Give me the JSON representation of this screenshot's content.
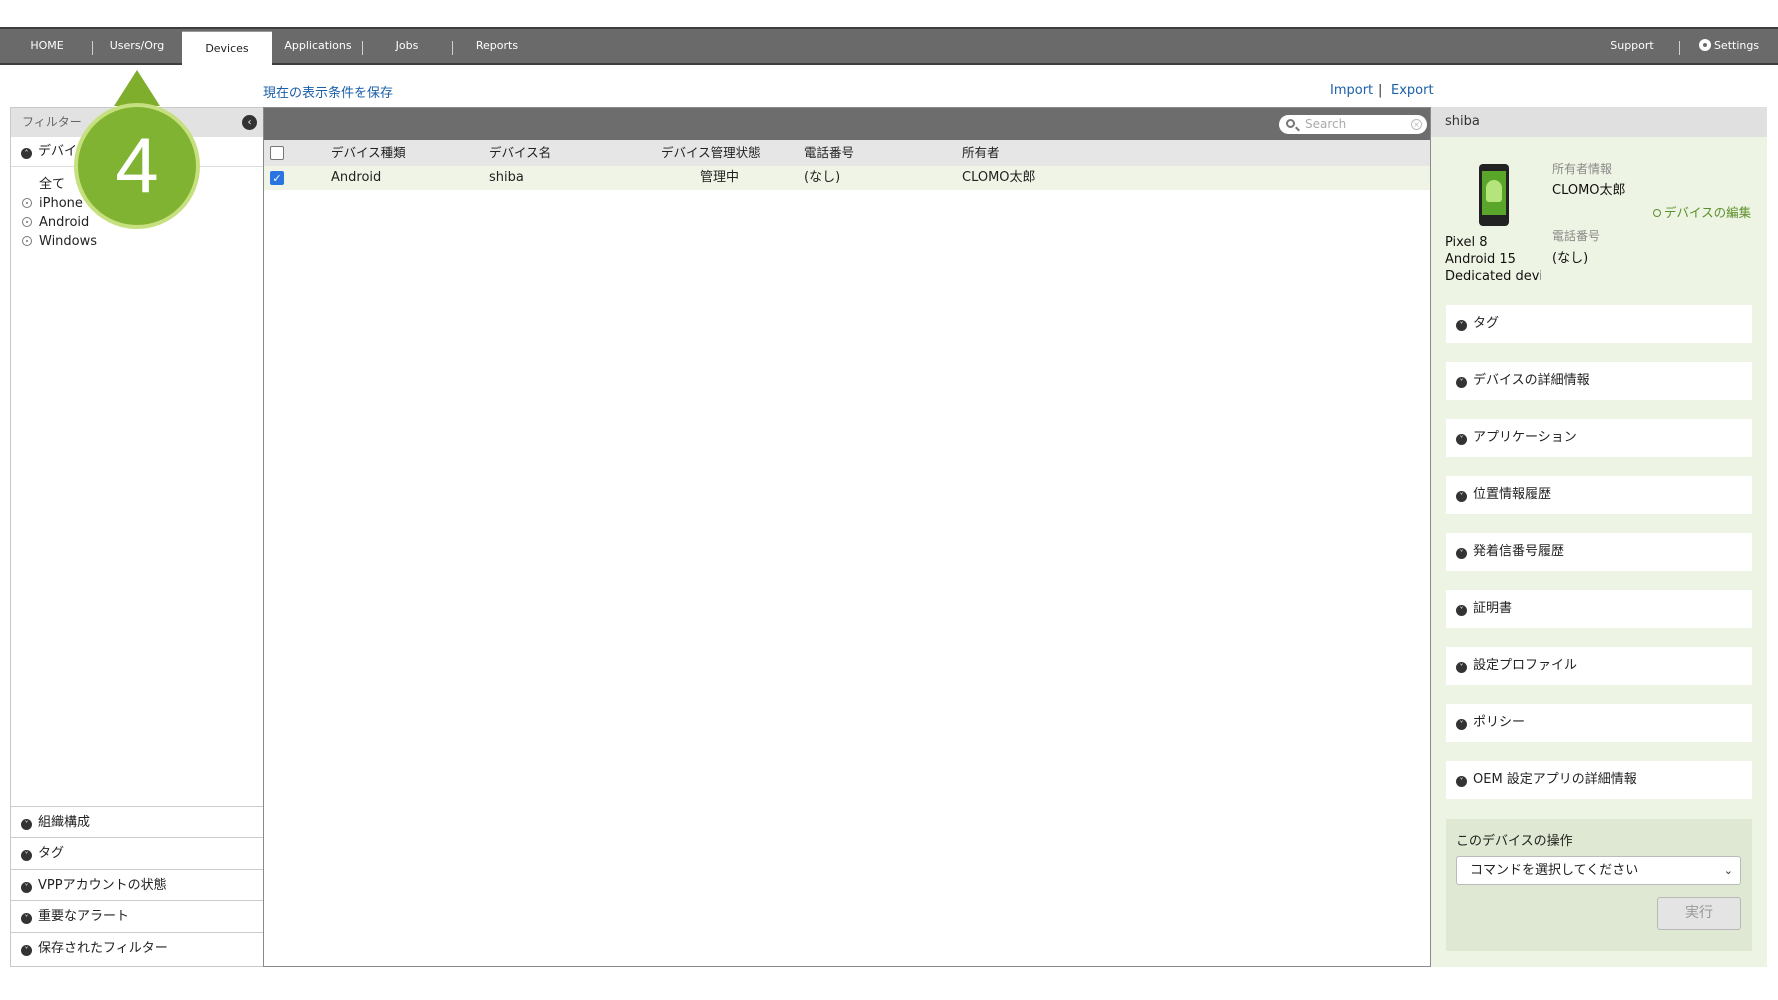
{
  "nav": {
    "tabs": [
      "HOME",
      "Users/Org",
      "Devices",
      "Applications",
      "Jobs",
      "Reports"
    ],
    "active_tab": "Devices",
    "support": "Support",
    "settings": "Settings"
  },
  "toolbar": {
    "save_view": "現在の表示条件を保存",
    "import": "Import",
    "separator": "|",
    "export": "Export"
  },
  "filter": {
    "header": "フィルター",
    "device_section": "デバイ",
    "options": [
      "全て",
      "iPhone",
      "Android",
      "Windows"
    ],
    "bottom_sections": [
      "組織構成",
      "タグ",
      "VPPアカウントの状態",
      "重要なアラート",
      "保存されたフィルター"
    ]
  },
  "list": {
    "search_placeholder": "Search",
    "columns": [
      "デバイス種類",
      "デバイス名",
      "デバイス管理状態",
      "電話番号",
      "所有者"
    ],
    "rows": [
      {
        "type": "Android",
        "name": "shiba",
        "status": "管理中",
        "phone": "(なし)",
        "owner": "CLOMO太郎",
        "checked": true
      }
    ]
  },
  "detail": {
    "title": "shiba",
    "model": "Pixel 8",
    "os": "Android 15",
    "mode": "Dedicated devic",
    "owner_label": "所有者情報",
    "owner": "CLOMO太郎",
    "edit_link": "デバイスの編集",
    "phone_label": "電話番号",
    "phone": "(なし)",
    "sections": [
      "タグ",
      "デバイスの詳細情報",
      "アプリケーション",
      "位置情報履歴",
      "発着信番号履歴",
      "証明書",
      "設定プロファイル",
      "ポリシー",
      "OEM 設定アプリの詳細情報"
    ],
    "ops_title": "このデバイスの操作",
    "command_placeholder": "コマンドを選択してください",
    "run_button": "実行"
  },
  "callout": {
    "number": "4"
  },
  "colors": {
    "nav_bg": "#6a6a6a",
    "accent_green": "#7fb331",
    "link_blue": "#1a5fa8",
    "detail_bg": "#eef4e3"
  }
}
